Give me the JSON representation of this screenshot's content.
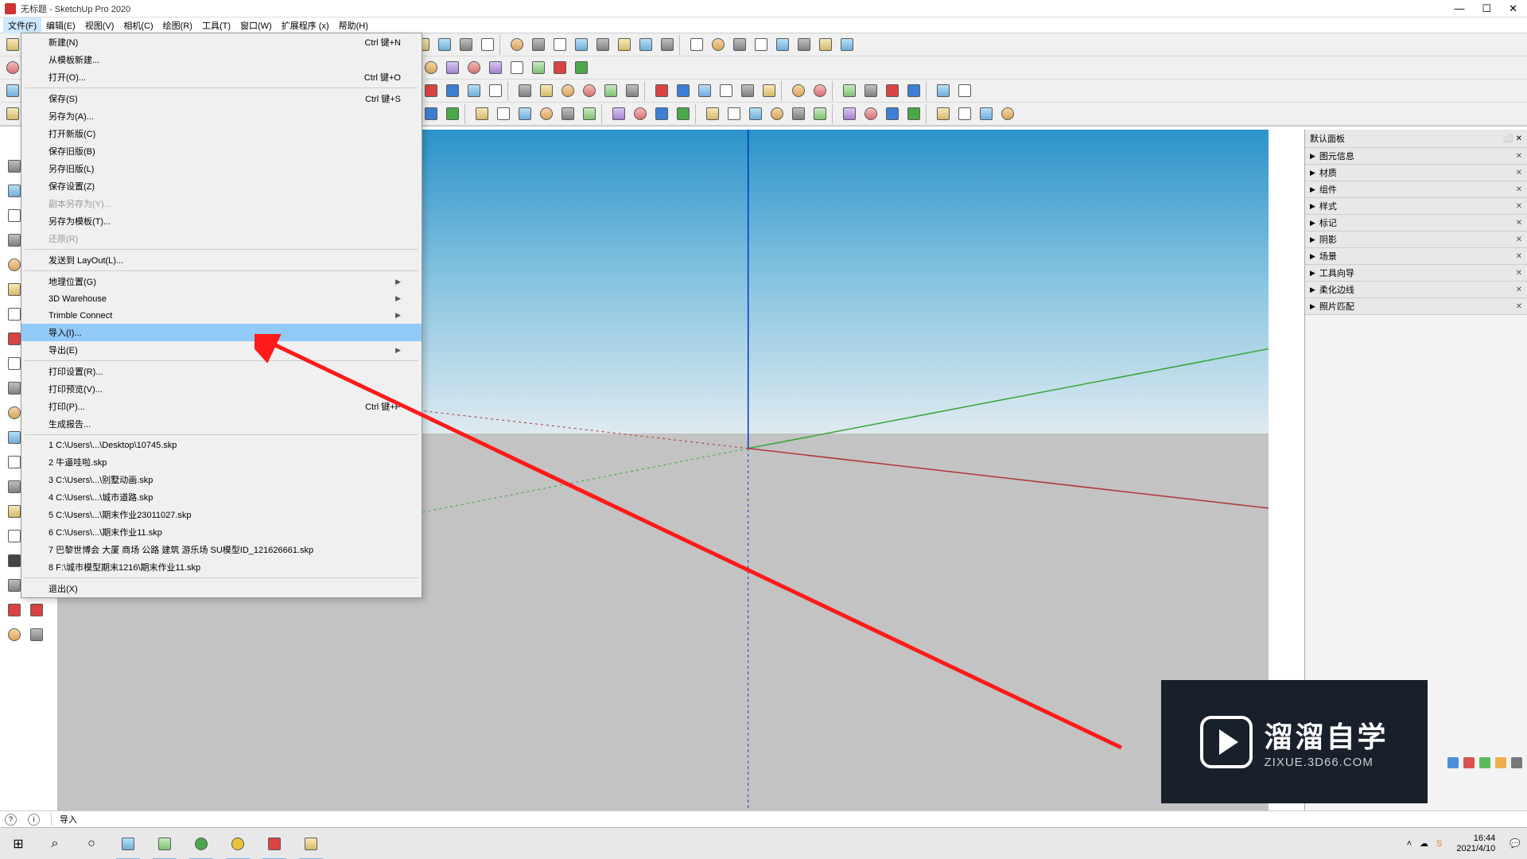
{
  "title": "无标题 - SketchUp Pro 2020",
  "menubar": [
    "文件(F)",
    "编辑(E)",
    "视图(V)",
    "相机(C)",
    "绘图(R)",
    "工具(T)",
    "窗口(W)",
    "扩展程序 (x)",
    "帮助(H)"
  ],
  "activeMenuIndex": 0,
  "fileMenu": {
    "groups": [
      [
        {
          "label": "新建(N)",
          "shortcut": "Ctrl 键+N"
        },
        {
          "label": "从模板新建..."
        },
        {
          "label": "打开(O)...",
          "shortcut": "Ctrl 键+O"
        }
      ],
      [
        {
          "label": "保存(S)",
          "shortcut": "Ctrl 键+S"
        },
        {
          "label": "另存为(A)..."
        },
        {
          "label": "打开新版(C)"
        },
        {
          "label": "保存旧版(B)"
        },
        {
          "label": "另存旧版(L)"
        },
        {
          "label": "保存设置(Z)"
        },
        {
          "label": "副本另存为(Y)...",
          "disabled": true
        },
        {
          "label": "另存为模板(T)..."
        },
        {
          "label": "还原(R)",
          "disabled": true
        }
      ],
      [
        {
          "label": "发送到 LayOut(L)..."
        }
      ],
      [
        {
          "label": "地理位置(G)",
          "submenu": true
        },
        {
          "label": "3D Warehouse",
          "submenu": true
        },
        {
          "label": "Trimble Connect",
          "submenu": true
        },
        {
          "label": "导入(I)...",
          "highlight": true
        },
        {
          "label": "导出(E)",
          "submenu": true
        }
      ],
      [
        {
          "label": "打印设置(R)..."
        },
        {
          "label": "打印预览(V)..."
        },
        {
          "label": "打印(P)...",
          "shortcut": "Ctrl 键+P"
        },
        {
          "label": "生成报告..."
        }
      ],
      [
        {
          "label": "1 C:\\Users\\...\\Desktop\\10745.skp"
        },
        {
          "label": "2 牛逼哇啦.skp"
        },
        {
          "label": "3 C:\\Users\\...\\别墅动画.skp"
        },
        {
          "label": "4 C:\\Users\\...\\城市道路.skp"
        },
        {
          "label": "5 C:\\Users\\...\\期末作业23011027.skp"
        },
        {
          "label": "6 C:\\Users\\...\\期末作业11.skp"
        },
        {
          "label": "7 巴黎世博会 大厦 商场 公路 建筑 游乐场 SU模型ID_121626661.skp"
        },
        {
          "label": "8 F:\\城市模型期末1216\\期末作业11.skp"
        }
      ],
      [
        {
          "label": "退出(X)"
        }
      ]
    ]
  },
  "rightPanel": {
    "title": "默认面板",
    "sections": [
      "图元信息",
      "材质",
      "组件",
      "样式",
      "标记",
      "阴影",
      "场景",
      "工具向导",
      "柔化边线",
      "照片匹配"
    ]
  },
  "statusbar": {
    "hint": "导入"
  },
  "watermark": {
    "big": "溜溜自学",
    "small": "ZIXUE.3D66.COM"
  },
  "taskbar": {
    "time": "16:44",
    "date": "2021/4/10"
  }
}
